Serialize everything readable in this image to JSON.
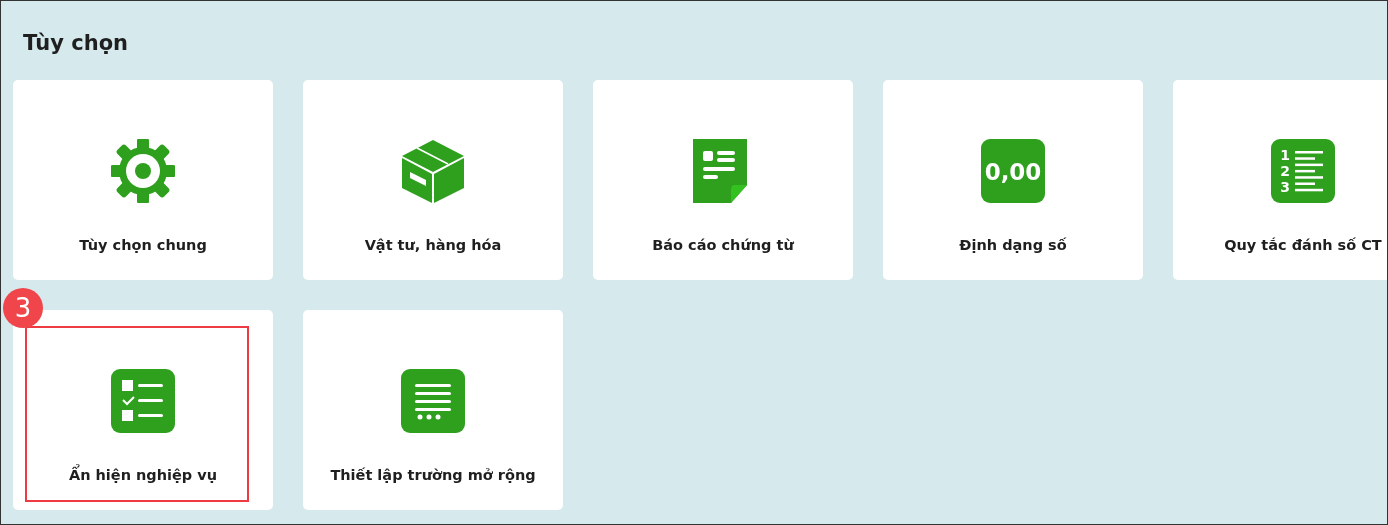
{
  "title": "Tùy chọn",
  "cards": [
    {
      "kind": "gear",
      "label": "Tùy chọn chung",
      "highlighted": false
    },
    {
      "kind": "box",
      "label": "Vật tư, hàng hóa",
      "highlighted": false
    },
    {
      "kind": "document",
      "label": "Báo cáo chứng từ",
      "highlighted": false
    },
    {
      "kind": "number-format",
      "label": "Định dạng số",
      "icon_text": "0,00",
      "highlighted": false
    },
    {
      "kind": "numbered-list",
      "label": "Quy tắc đánh số CT",
      "icon_digits": [
        "1",
        "2",
        "3"
      ],
      "highlighted": false
    },
    {
      "kind": "checklist",
      "label": "Ẩn hiện nghiệp vụ",
      "highlighted": true,
      "callout": "3"
    },
    {
      "kind": "text-lines",
      "label": "Thiết lập trường mở rộng",
      "highlighted": false
    }
  ]
}
